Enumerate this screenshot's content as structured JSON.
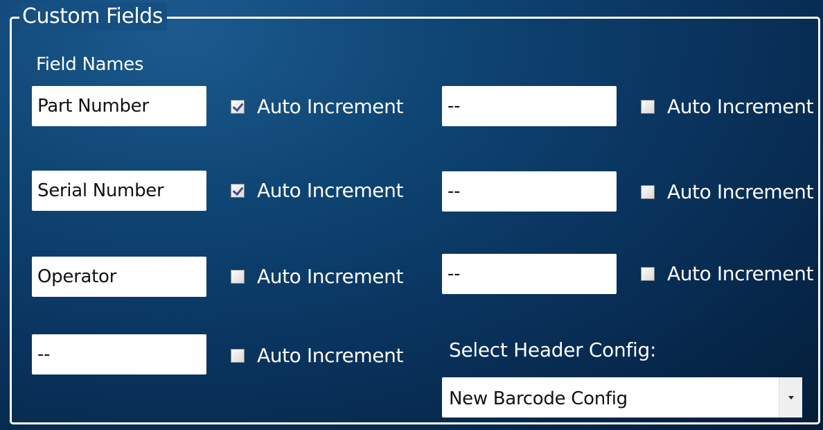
{
  "group": {
    "title": "Custom Fields",
    "field_names_label": "Field Names"
  },
  "fields_left": [
    {
      "value": "Part Number",
      "auto_increment_label": "Auto Increment",
      "auto_increment_checked": true
    },
    {
      "value": "Serial Number",
      "auto_increment_label": "Auto Increment",
      "auto_increment_checked": true
    },
    {
      "value": "Operator",
      "auto_increment_label": "Auto Increment",
      "auto_increment_checked": false
    },
    {
      "value": "--",
      "auto_increment_label": "Auto Increment",
      "auto_increment_checked": false
    }
  ],
  "fields_right": [
    {
      "value": "--",
      "auto_increment_label": "Auto Increment",
      "auto_increment_checked": false
    },
    {
      "value": "--",
      "auto_increment_label": "Auto Increment",
      "auto_increment_checked": false
    },
    {
      "value": "--",
      "auto_increment_label": "Auto Increment",
      "auto_increment_checked": false
    }
  ],
  "header_config": {
    "label": "Select Header  Config:",
    "selected": "New Barcode Config",
    "icon": "chevron-down-icon"
  },
  "colors": {
    "background_dark": "#041d38",
    "background_light": "#1c5a8e",
    "text": "#ffffff",
    "check_mark": "#3d4e8e"
  }
}
